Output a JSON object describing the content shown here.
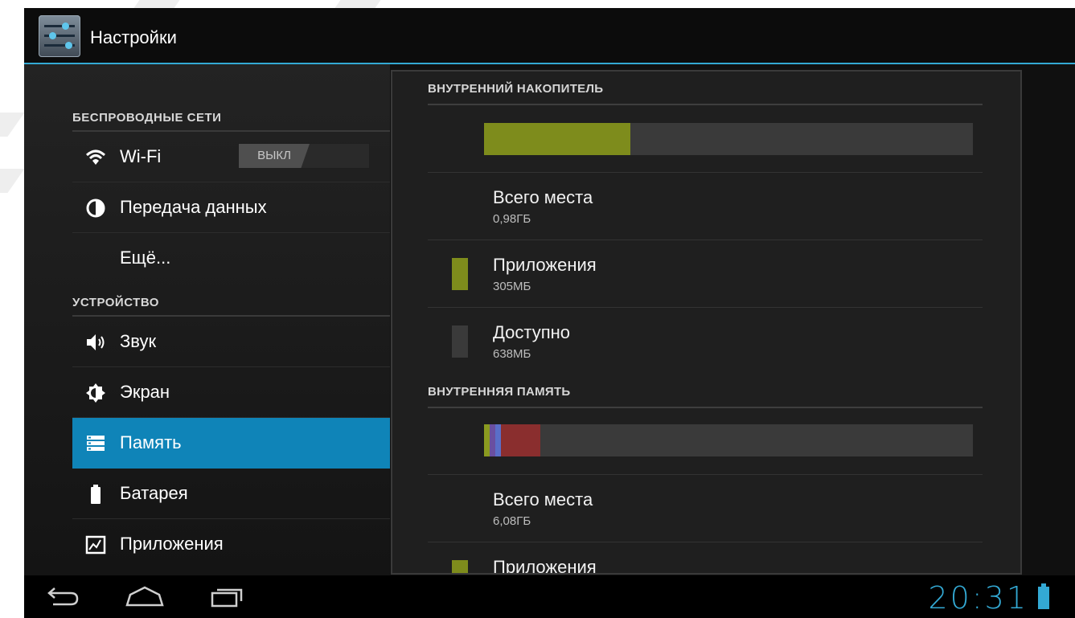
{
  "app": {
    "title": "Настройки",
    "icon": "settings-sliders-icon"
  },
  "sidebar": {
    "sections": [
      {
        "header": "БЕСПРОВОДНЫЕ СЕТИ"
      },
      {
        "header": "УСТРОЙСТВО"
      }
    ],
    "items": [
      {
        "label": "Wi-Fi",
        "icon": "wifi-icon",
        "toggle": "ВЫКЛ"
      },
      {
        "label": "Передача данных",
        "icon": "data-usage-icon"
      },
      {
        "label": "Ещё..."
      },
      {
        "label": "Звук",
        "icon": "volume-icon"
      },
      {
        "label": "Экран",
        "icon": "brightness-icon"
      },
      {
        "label": "Память",
        "icon": "storage-icon",
        "selected": true
      },
      {
        "label": "Батарея",
        "icon": "battery-icon"
      },
      {
        "label": "Приложения",
        "icon": "apps-icon"
      }
    ]
  },
  "storage": {
    "internal_storage": {
      "header": "ВНУТРЕННИЙ НАКОПИТЕЛЬ",
      "usage_fraction": 0.3,
      "rows": [
        {
          "title": "Всего места",
          "value": "0,98ГБ"
        },
        {
          "title": "Приложения",
          "value": "305МБ",
          "color": "#7e8c1c"
        },
        {
          "title": "Доступно",
          "value": "638МБ",
          "color": "#3a3a3a"
        }
      ]
    },
    "internal_memory": {
      "header": "ВНУТРЕННЯЯ ПАМЯТЬ",
      "segments": [
        {
          "fraction": 0.012,
          "color": "#8a9a20"
        },
        {
          "fraction": 0.012,
          "color": "#6a4fa0"
        },
        {
          "fraction": 0.012,
          "color": "#5a6ec8"
        },
        {
          "fraction": 0.08,
          "color": "#8a2e2e"
        }
      ],
      "rows": [
        {
          "title": "Всего места",
          "value": "6,08ГБ"
        },
        {
          "title": "Приложения",
          "color": "#7e8c1c"
        }
      ]
    }
  },
  "navbar": {
    "back_icon": "back-icon",
    "home_icon": "home-icon",
    "recents_icon": "recents-icon",
    "time": "20:31",
    "battery_icon": "battery-status-icon",
    "accent": "#33a9d4"
  }
}
